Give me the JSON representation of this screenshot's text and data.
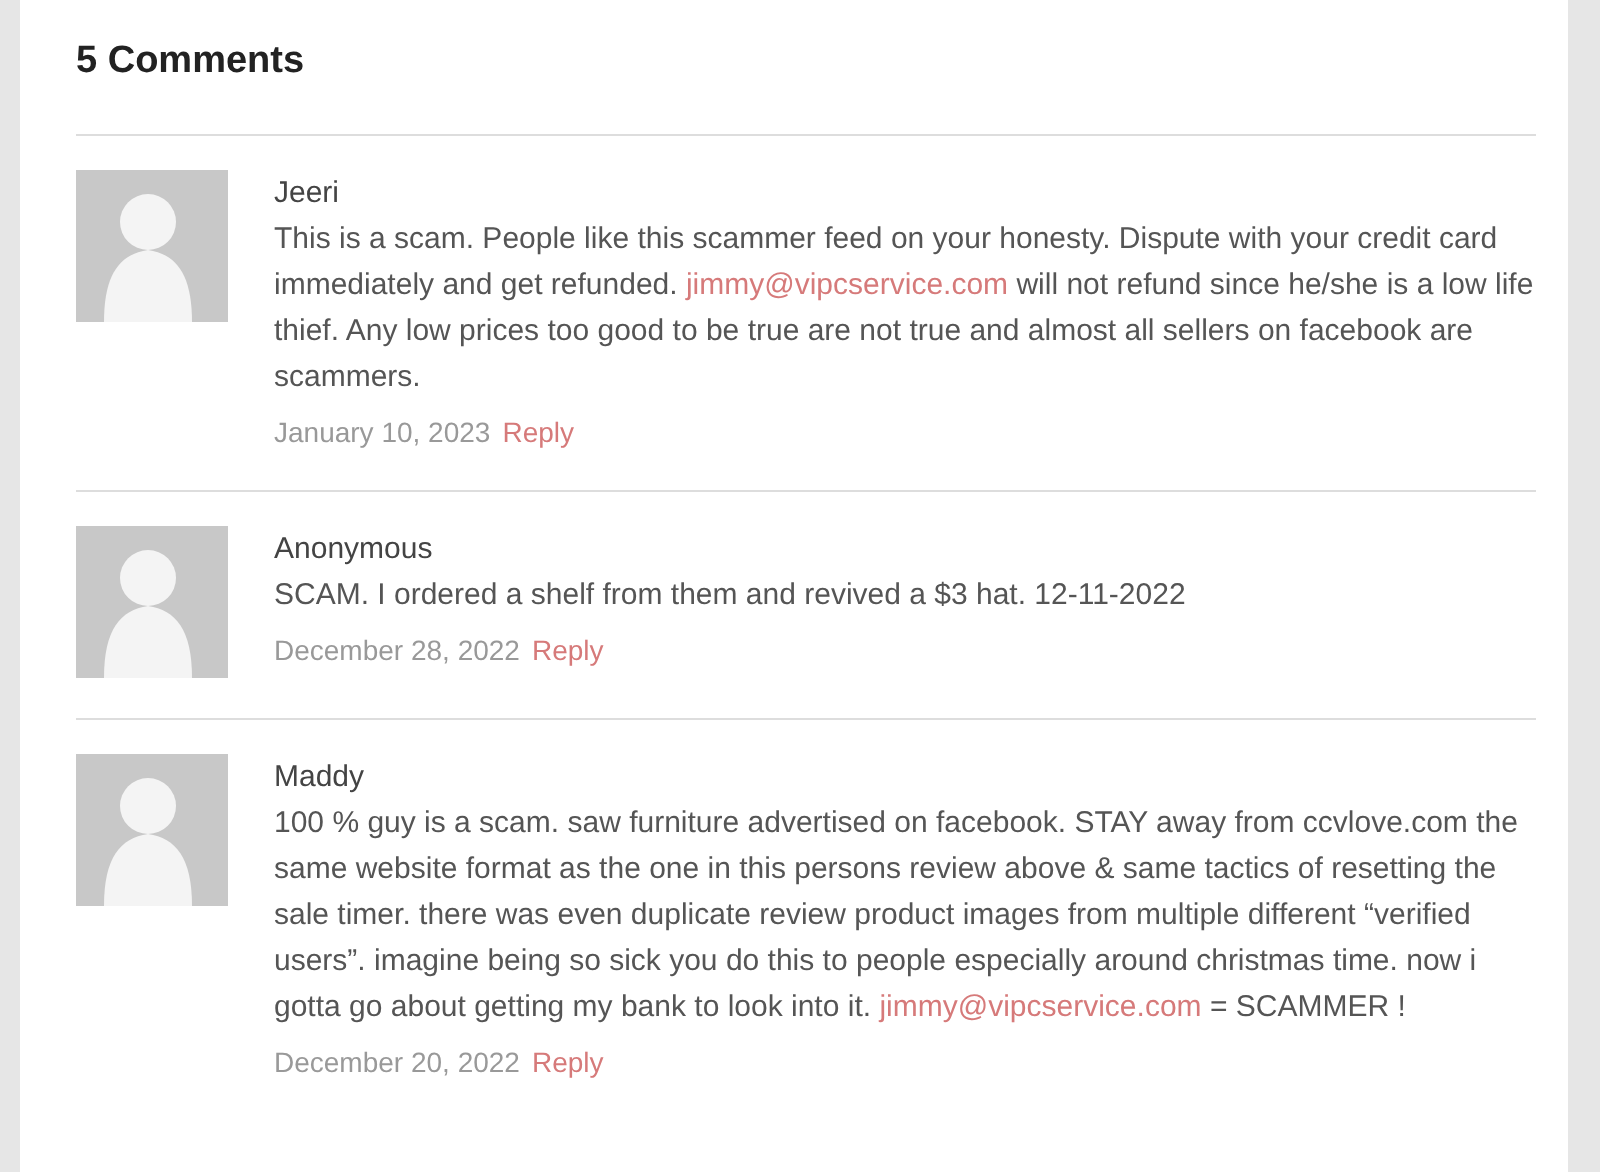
{
  "heading": "5 Comments",
  "comments": [
    {
      "author": "Jeeri",
      "body": [
        {
          "kind": "text",
          "text": "This is a scam. People like this scammer feed on your honesty. Dispute with your credit card immediately and get refunded. "
        },
        {
          "kind": "link",
          "text": "jimmy@vipcservice.com"
        },
        {
          "kind": "text",
          "text": " will not refund since he/she is a low life thief. Any low prices too good to be true are not true and almost all sellers on facebook are scammers."
        }
      ],
      "date": "January 10, 2023",
      "reply": "Reply"
    },
    {
      "author": "Anonymous",
      "body": [
        {
          "kind": "text",
          "text": "SCAM. I ordered a shelf from them and revived a $3 hat. 12-11-2022"
        }
      ],
      "date": "December 28, 2022",
      "reply": "Reply"
    },
    {
      "author": "Maddy",
      "body": [
        {
          "kind": "text",
          "text": "100 % guy is a scam. saw furniture advertised on facebook. STAY away from ccvlove.com the same website format as the one in this persons review above & same tactics of resetting the sale timer. there was even duplicate review product images from multiple different “verified users”. imagine being so sick you do this to people especially around christmas time. now i gotta go about getting my bank to look into it. "
        },
        {
          "kind": "link",
          "text": "jimmy@vipcservice.com"
        },
        {
          "kind": "text",
          "text": " = SCAMMER !"
        }
      ],
      "date": "December 20, 2022",
      "reply": "Reply"
    }
  ]
}
